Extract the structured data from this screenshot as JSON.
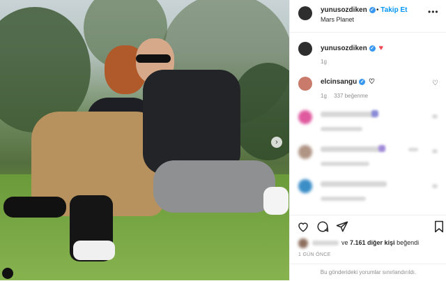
{
  "post": {
    "username": "yunusozdiken",
    "location": "Mars Planet",
    "follow_label": "Takip Et",
    "more": "•••"
  },
  "caption": {
    "username": "yunusozdiken",
    "time": "1g"
  },
  "comments": [
    {
      "username": "elcinsangu",
      "time": "1g",
      "likes": "337 beğenme"
    }
  ],
  "likes": {
    "prefix": "ve",
    "count": "7.161 diğer kişi",
    "suffix": "beğendi"
  },
  "post_date": "1 GÜN ÖNCE",
  "footer_note": "Bu gönderideki yorumlar sınırlandırıldı.",
  "colors": {
    "verified": "#3897f0",
    "follow": "#0095f6",
    "heart": "#ed4956"
  },
  "icons": [
    "verified-badge-icon",
    "heart-icon",
    "like-icon",
    "comment-icon",
    "share-icon",
    "save-icon",
    "next-arrow-icon"
  ]
}
